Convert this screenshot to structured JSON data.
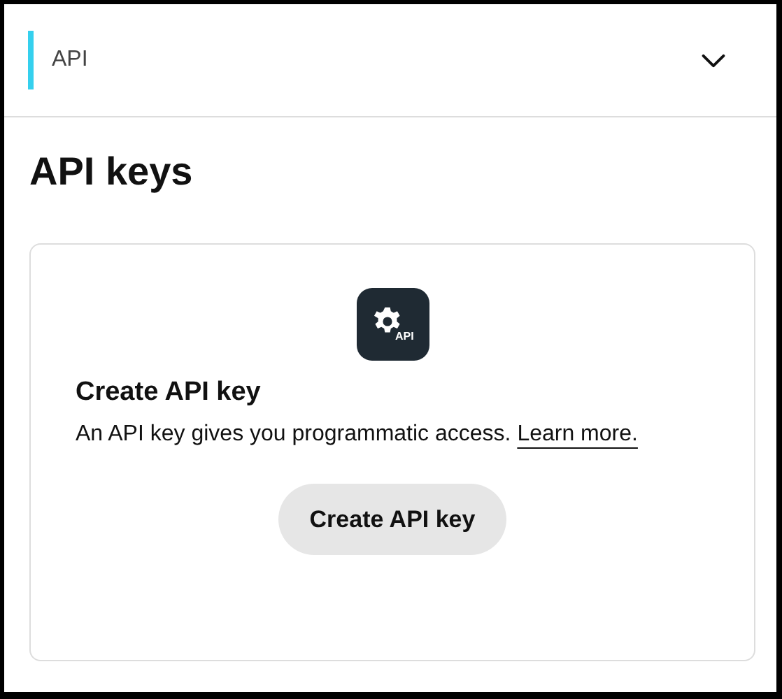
{
  "section_header": {
    "label": "API",
    "expanded": false
  },
  "page_title": "API keys",
  "empty_state": {
    "icon_label": "API",
    "heading": "Create API key",
    "description": "An API key gives you programmatic access. ",
    "link": "Learn more.",
    "button": "Create API key"
  }
}
